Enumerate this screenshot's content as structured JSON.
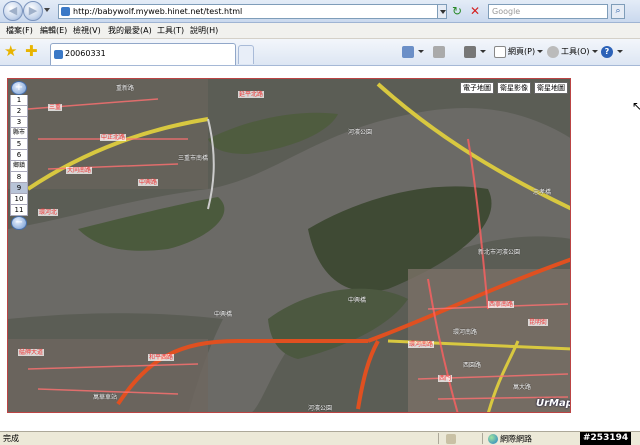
{
  "browser": {
    "address": "http://babywolf.myweb.hinet.net/test.html",
    "search_placeholder": "Google",
    "back_glyph": "◀",
    "forward_glyph": "▶",
    "refresh_glyph": "↻",
    "stop_glyph": "✕",
    "search_glyph": "⌕"
  },
  "menu": [
    "檔案(F)",
    "編輯(E)",
    "檢視(V)",
    "我的最愛(A)",
    "工具(T)",
    "說明(H)"
  ],
  "tabs": [
    {
      "label": "20060331"
    }
  ],
  "commands": {
    "page": "網頁(P)",
    "tools": "工具(O)",
    "help": "?"
  },
  "map": {
    "type_buttons": [
      "電子地圖",
      "衛星影像",
      "衛星地圖"
    ],
    "zoom_levels": [
      "1",
      "2",
      "3",
      "縣市",
      "5",
      "6",
      "鄉鎮",
      "8",
      "9",
      "10",
      "11"
    ],
    "selected_level": "9",
    "zoom_in_glyph": "+",
    "zoom_out_glyph": "−",
    "logo": "UrMap",
    "labels": [
      "重新路",
      "三重市南橋",
      "河濱公園",
      "忠孝橋",
      "新北市河濱公園",
      "中興橋",
      "中興橋",
      "環河南路",
      "西園路",
      "萬華車站",
      "河濱公園",
      "萬大路"
    ],
    "road_labels": [
      "三重",
      "中正北路",
      "大同南路",
      "中興路",
      "環河北",
      "延平北路",
      "環河南路",
      "西寧南路",
      "昆明街",
      "西門",
      "和平西路",
      "艋舺大道"
    ]
  },
  "status": {
    "text": "完成",
    "zone": "網際網路",
    "watermark": "#253194"
  }
}
